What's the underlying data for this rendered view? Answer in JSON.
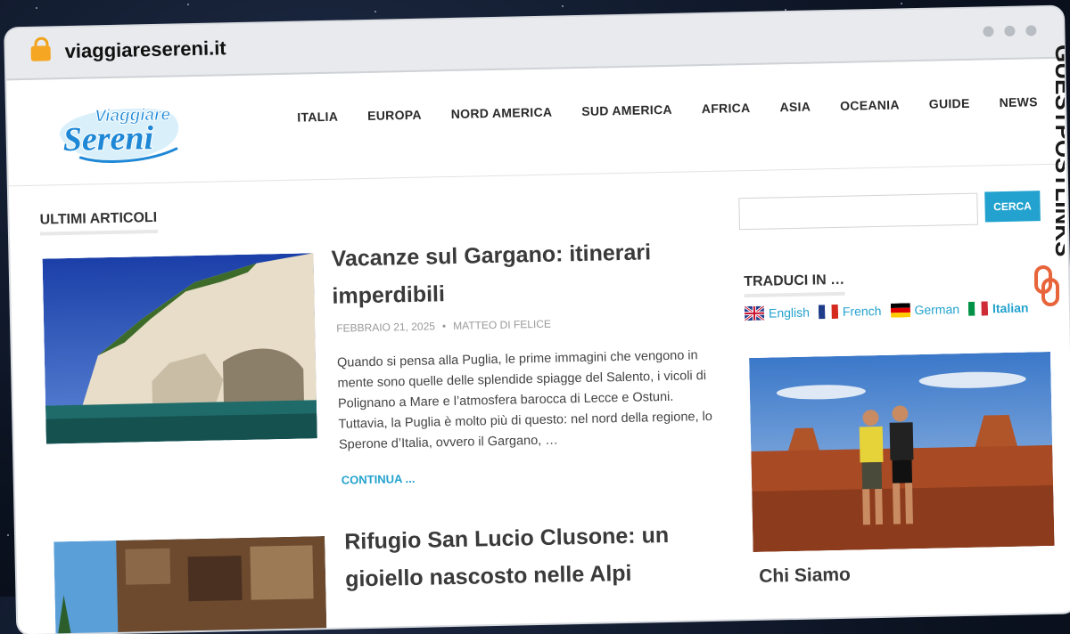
{
  "browser": {
    "url": "viaggiaresereni.it"
  },
  "logo": {
    "line1": "Viaggiare",
    "line2": "Sereni",
    "colors": {
      "blue": "#1e88d6",
      "white": "#ffffff"
    }
  },
  "nav": {
    "items": [
      "ITALIA",
      "EUROPA",
      "NORD AMERICA",
      "SUD AMERICA",
      "AFRICA",
      "ASIA",
      "OCEANIA",
      "GUIDE",
      "NEWS"
    ]
  },
  "main": {
    "section_title": "ULTIMI ARTICOLI",
    "posts": [
      {
        "title_line1": "Vacanze sul Gargano: itinerari",
        "title_line2": "imperdibili",
        "date": "FEBBRAIO 21, 2025",
        "author": "MATTEO DI FELICE",
        "excerpt": "Quando si pensa alla Puglia, le prime immagini che vengono in mente sono quelle delle splendide spiagge del Salento, i vicoli di Polignano a Mare e l’atmosfera barocca di Lecce e Ostuni. Tuttavia, la Puglia è molto più di questo: nel nord della regione, lo Sperone d’Italia, ovvero il Gargano, …",
        "continue_label": "CONTINUA ..."
      },
      {
        "title_line1": "Rifugio San Lucio Clusone: un",
        "title_line2": "gioiello nascosto nelle Alpi"
      }
    ]
  },
  "sidebar": {
    "search_button": "CERCA",
    "translate_title": "TRADUCI IN …",
    "languages": [
      {
        "label": "English",
        "flag": "uk-flag-icon"
      },
      {
        "label": "French",
        "flag": "france-flag-icon"
      },
      {
        "label": "German",
        "flag": "germany-flag-icon"
      },
      {
        "label": "Italian",
        "flag": "italy-flag-icon"
      }
    ],
    "about_title": "Chi Siamo"
  },
  "watermark": {
    "text": "GUESTPOSTLINKS",
    "accent": "#e8643a"
  },
  "colors": {
    "accent": "#23a2cf",
    "text": "#3a3a3a"
  }
}
